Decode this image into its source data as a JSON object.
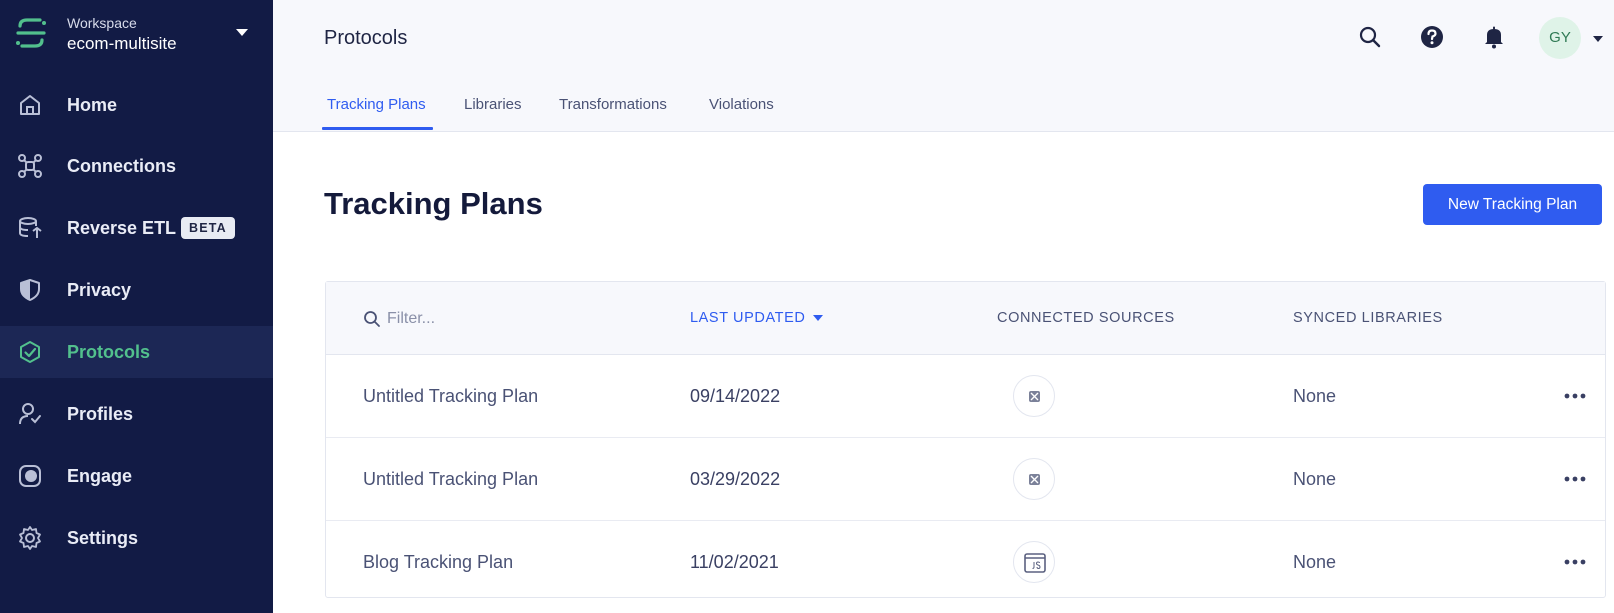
{
  "workspace": {
    "label": "Workspace",
    "name": "ecom-multisite"
  },
  "sidebar": {
    "items": [
      {
        "label": "Home",
        "icon": "home-icon"
      },
      {
        "label": "Connections",
        "icon": "connections-icon"
      },
      {
        "label": "Reverse ETL",
        "icon": "database-sync-icon",
        "badge": "BETA"
      },
      {
        "label": "Privacy",
        "icon": "shield-icon"
      },
      {
        "label": "Protocols",
        "icon": "protocols-icon",
        "active": true
      },
      {
        "label": "Profiles",
        "icon": "profile-icon"
      },
      {
        "label": "Engage",
        "icon": "engage-icon"
      },
      {
        "label": "Settings",
        "icon": "gear-icon"
      }
    ]
  },
  "header": {
    "title": "Protocols",
    "avatar_initials": "GY",
    "icons": [
      "search-icon",
      "help-icon",
      "bell-icon"
    ],
    "tabs": [
      {
        "label": "Tracking Plans",
        "active": true
      },
      {
        "label": "Libraries"
      },
      {
        "label": "Transformations"
      },
      {
        "label": "Violations"
      }
    ]
  },
  "main": {
    "title": "Tracking Plans",
    "new_button": "New Tracking Plan",
    "filter_placeholder": "Filter...",
    "columns": [
      "LAST UPDATED",
      "CONNECTED SOURCES",
      "SYNCED LIBRARIES"
    ],
    "rows": [
      {
        "name": "Untitled Tracking Plan",
        "updated": "09/14/2022",
        "source_icon": "generic-source-icon",
        "libraries": "None"
      },
      {
        "name": "Untitled Tracking Plan",
        "updated": "03/29/2022",
        "source_icon": "generic-source-icon",
        "libraries": "None"
      },
      {
        "name": "Blog Tracking Plan",
        "updated": "11/02/2021",
        "source_icon": "javascript-source-icon",
        "libraries": "None"
      }
    ]
  },
  "colors": {
    "sidebar_bg": "#121b45",
    "accent_green": "#52c08d",
    "primary_blue": "#2f5cf0"
  }
}
